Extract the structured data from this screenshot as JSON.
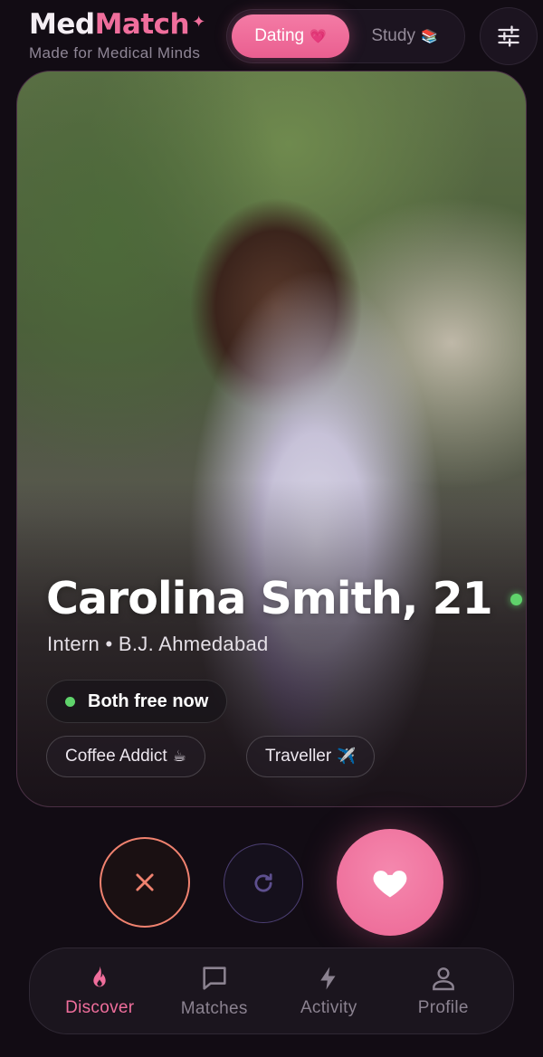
{
  "app": {
    "name_part1": "Med",
    "name_part2": "Match",
    "sparkle": "✦",
    "tagline": "Made for Medical Minds"
  },
  "mode_toggle": {
    "active": {
      "label": "Dating",
      "emoji": "💗"
    },
    "inactive": {
      "label": "Study",
      "emoji": "📚"
    }
  },
  "filter_icon": "sliders-icon",
  "profile": {
    "name": "Carolina Smith, 21",
    "online": true,
    "role": "Intern",
    "separator": "•",
    "institution": "B.J. Ahmedabad",
    "availability": "Both free now",
    "interests": [
      {
        "label": "Coffee Addict",
        "emoji": "☕"
      },
      {
        "label": "Traveller",
        "emoji": "✈️"
      }
    ]
  },
  "actions": {
    "pass_icon": "close-icon",
    "undo_icon": "refresh-icon",
    "like_icon": "heart-icon"
  },
  "nav": {
    "items": [
      {
        "label": "Discover",
        "icon": "flame-icon",
        "active": true
      },
      {
        "label": "Matches",
        "icon": "chat-bubble-icon",
        "active": false
      },
      {
        "label": "Activity",
        "icon": "bolt-icon",
        "active": false
      },
      {
        "label": "Profile",
        "icon": "user-icon",
        "active": false
      }
    ]
  },
  "colors": {
    "background": "#120c14",
    "accent_pink": "#f06e9c",
    "online_green": "#5fd36b",
    "pass_coral": "#f0826f",
    "undo_purple": "#4c3f73"
  }
}
